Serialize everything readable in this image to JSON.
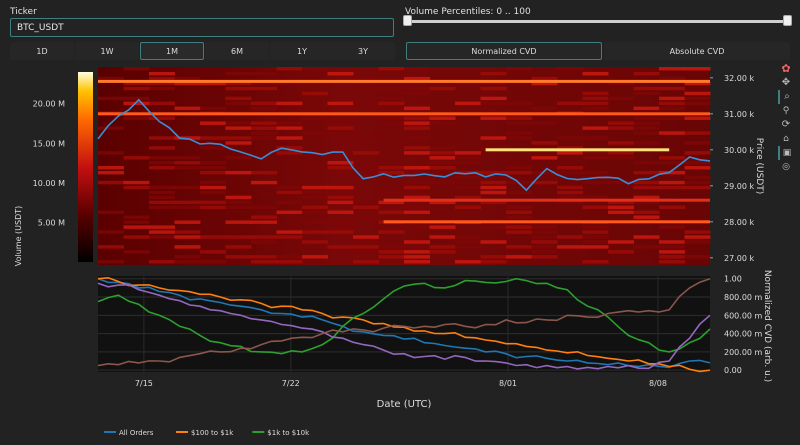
{
  "controls": {
    "ticker_label": "Ticker",
    "ticker_value": "BTC_USDT",
    "volume_label": "Volume Percentiles: 0 .. 100",
    "slider": {
      "min": 0,
      "max": 100,
      "low": 0,
      "high": 100
    },
    "timeframes": [
      {
        "label": "1D",
        "active": false
      },
      {
        "label": "1W",
        "active": false
      },
      {
        "label": "1M",
        "active": true
      },
      {
        "label": "6M",
        "active": false
      },
      {
        "label": "1Y",
        "active": false
      },
      {
        "label": "3Y",
        "active": false
      }
    ],
    "modes": [
      {
        "label": "Normalized CVD",
        "active": true
      },
      {
        "label": "Absolute CVD",
        "active": false
      }
    ]
  },
  "toolbar": [
    "plotly-logo-icon",
    "pan-icon",
    "zoom-icon",
    "box-select-icon",
    "autoscale-icon",
    "reset-icon",
    "camera-icon",
    "spike-icon"
  ],
  "chart_data": [
    {
      "type": "heatmap",
      "xlabel": "",
      "ylabel_left": "Volume (USDT)",
      "ylabel_right": "Price (USDT)",
      "volume_scale_ticks": [
        "5.00 M",
        "10.00 M",
        "15.00 M",
        "20.00 M"
      ],
      "volume_scale_values": [
        5,
        10,
        15,
        20
      ],
      "volume_scale_range": [
        0,
        24
      ],
      "price_ticks": [
        "27.00 k",
        "28.00 k",
        "29.00 k",
        "30.00 k",
        "31.00 k",
        "32.00 k"
      ],
      "price_tick_values": [
        27000,
        28000,
        29000,
        30000,
        31000,
        32000
      ],
      "ylim": [
        26800,
        32300
      ],
      "price_series": {
        "name": "",
        "x": [
          "7/12",
          "7/13",
          "7/13.5",
          "7/14",
          "7/15",
          "7/16",
          "7/17",
          "7/18",
          "7/19",
          "7/20",
          "7/21",
          "7/22",
          "7/23",
          "7/24",
          "7/25",
          "7/26",
          "7/27",
          "7/28",
          "7/29",
          "7/30",
          "7/31",
          "8/01",
          "8/02",
          "8/03",
          "8/04",
          "8/05",
          "8/06",
          "8/07",
          "8/08",
          "8/09",
          "8/10"
        ],
        "values": [
          30300,
          30900,
          31400,
          30800,
          30300,
          30200,
          30100,
          29900,
          29800,
          30000,
          29900,
          29850,
          29900,
          29200,
          29300,
          29300,
          29350,
          29300,
          29350,
          29300,
          29350,
          28900,
          29500,
          29200,
          29150,
          29200,
          29100,
          29150,
          29400,
          29800,
          29650
        ]
      },
      "bands": [
        {
          "price": 31900,
          "intensity": 0.85
        },
        {
          "price": 31000,
          "intensity": 0.75
        },
        {
          "price": 30000,
          "intensity": 1.0,
          "from": "7/30",
          "to": "8/08"
        },
        {
          "price": 28000,
          "intensity": 0.8,
          "from": "7/25"
        },
        {
          "price": 28600,
          "intensity": 0.6,
          "from": "7/25"
        }
      ]
    },
    {
      "type": "line",
      "xlabel": "Date (UTC)",
      "ylabel": "Normalized CVD (arb. u.)",
      "x_ticks": [
        "7/15",
        "7/22",
        "8/01",
        "8/08"
      ],
      "y_ticks": [
        "0.00",
        "200.00 m",
        "400.00 m",
        "600.00 m",
        "800.00 m",
        "1.00"
      ],
      "y_tick_values": [
        0,
        0.2,
        0.4,
        0.6,
        0.8,
        1.0
      ],
      "ylim": [
        -0.02,
        1.03
      ],
      "x": [
        0,
        1,
        2,
        3,
        4,
        5,
        6,
        7,
        8,
        9,
        10,
        11,
        12,
        13,
        14,
        15,
        16,
        17,
        18,
        19,
        20,
        21,
        22,
        23,
        24,
        25,
        26,
        27,
        28,
        29,
        30
      ],
      "series": [
        {
          "name": "All Orders",
          "color": "#1f77b4",
          "values": [
            1.0,
            0.96,
            0.9,
            0.86,
            0.82,
            0.78,
            0.74,
            0.7,
            0.66,
            0.62,
            0.58,
            0.55,
            0.48,
            0.42,
            0.38,
            0.34,
            0.3,
            0.27,
            0.24,
            0.2,
            0.18,
            0.15,
            0.13,
            0.1,
            0.08,
            0.06,
            0.05,
            0.06,
            0.03,
            0.1,
            0.08
          ]
        },
        {
          "name": "$100 to $1k",
          "color": "#ff7f0e",
          "values": [
            1.0,
            0.97,
            0.93,
            0.9,
            0.87,
            0.83,
            0.8,
            0.77,
            0.73,
            0.7,
            0.66,
            0.62,
            0.58,
            0.55,
            0.51,
            0.47,
            0.43,
            0.4,
            0.36,
            0.33,
            0.29,
            0.26,
            0.22,
            0.19,
            0.16,
            0.13,
            0.1,
            0.07,
            0.04,
            0.01,
            0.0
          ]
        },
        {
          "name": "$1k to $10k",
          "color": "#2ca02c",
          "values": [
            0.75,
            0.82,
            0.72,
            0.6,
            0.48,
            0.38,
            0.3,
            0.26,
            0.2,
            0.18,
            0.2,
            0.28,
            0.48,
            0.62,
            0.78,
            0.92,
            0.95,
            0.9,
            0.98,
            0.96,
            0.97,
            0.98,
            0.95,
            0.88,
            0.7,
            0.58,
            0.38,
            0.3,
            0.2,
            0.3,
            0.45
          ]
        },
        {
          "name": "",
          "color": "#9467bd",
          "values": [
            0.95,
            0.93,
            0.88,
            0.82,
            0.76,
            0.7,
            0.65,
            0.6,
            0.55,
            0.5,
            0.46,
            0.42,
            0.35,
            0.28,
            0.22,
            0.18,
            0.15,
            0.12,
            0.14,
            0.1,
            0.08,
            0.06,
            0.05,
            0.04,
            0.03,
            0.04,
            0.05,
            0.02,
            0.1,
            0.35,
            0.6
          ]
        },
        {
          "name": "",
          "color": "#8c564b",
          "values": [
            0.05,
            0.06,
            0.08,
            0.1,
            0.14,
            0.18,
            0.2,
            0.24,
            0.28,
            0.32,
            0.36,
            0.4,
            0.42,
            0.44,
            0.46,
            0.48,
            0.48,
            0.5,
            0.48,
            0.5,
            0.55,
            0.52,
            0.55,
            0.6,
            0.58,
            0.62,
            0.65,
            0.65,
            0.66,
            0.9,
            1.0
          ]
        }
      ]
    }
  ]
}
